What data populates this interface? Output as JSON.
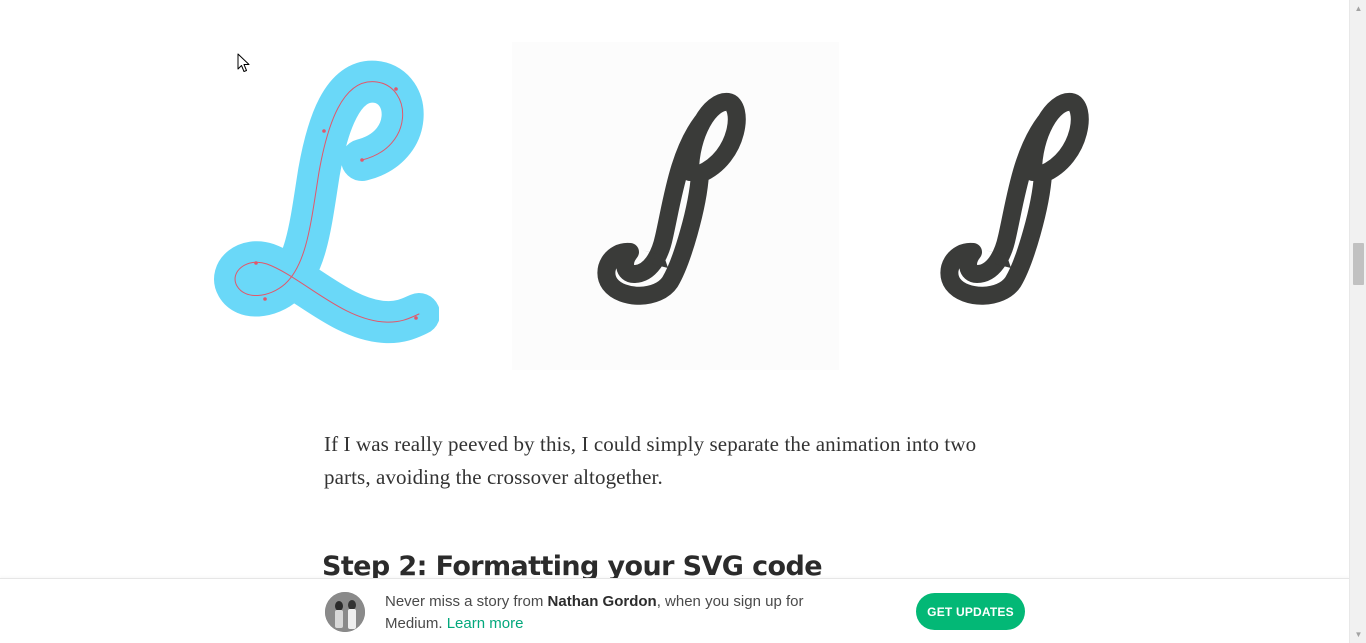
{
  "article": {
    "paragraph": "If I was really peeved by this, I could simply separate the animation into two parts, avoiding the crossover altogether.",
    "heading": "Step 2: Formatting your SVG code",
    "figure": {
      "stroke_color": "#6ad8f8",
      "path_color": "#e2576a",
      "letter_color": "#3a3b39"
    }
  },
  "cta": {
    "prefix": "Never miss a story from ",
    "author": "Nathan Gordon",
    "suffix": ", when you sign up for Medium.",
    "learn_more": "Learn more",
    "button": "GET UPDATES",
    "button_color": "#03b876"
  },
  "icons": {
    "cursor": "mouse-pointer-icon",
    "scroll_up": "chevron-up-icon",
    "scroll_down": "chevron-down-icon"
  }
}
